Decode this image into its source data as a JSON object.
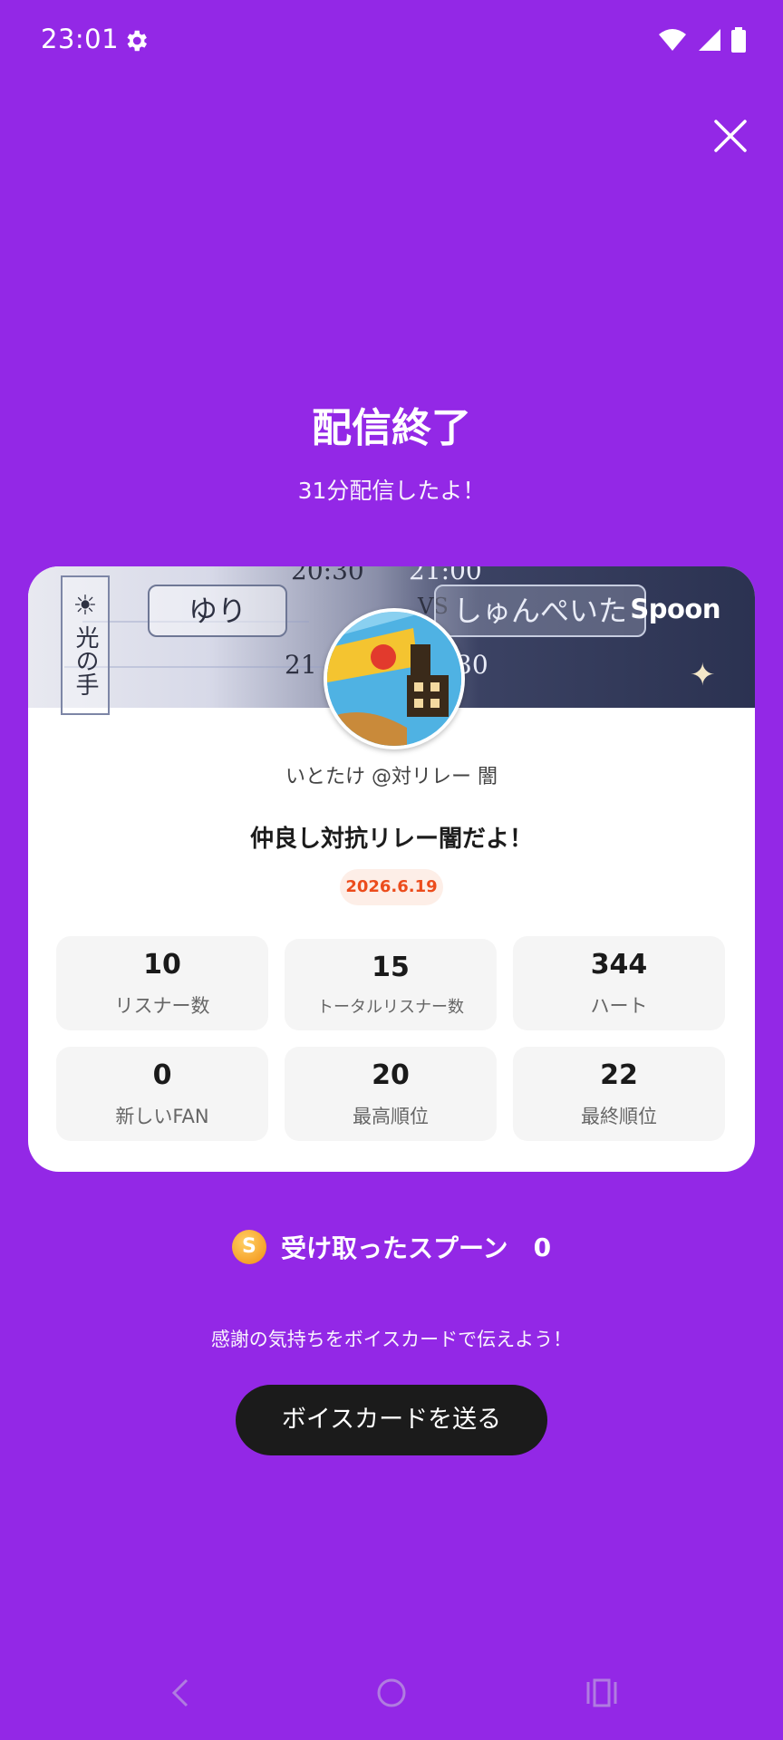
{
  "status_bar": {
    "time": "23:01"
  },
  "header": {
    "title": "配信終了",
    "subtitle": "31分配信したよ！"
  },
  "card": {
    "banner": {
      "texts": [
        "ゆり",
        "VS",
        "しゅんぺいた",
        "20:30",
        "21:00",
        "21",
        "30",
        "光の手"
      ],
      "logo": "Spoon"
    },
    "username": "いとたけ @対リレー 闇",
    "show_title": "仲良し対抗リレー闇だよ！",
    "date": "2026.6.19",
    "stats": [
      {
        "value": "10",
        "label": "リスナー数"
      },
      {
        "value": "15",
        "label": "トータルリスナー数"
      },
      {
        "value": "344",
        "label": "ハート"
      },
      {
        "value": "0",
        "label": "新しいFAN"
      },
      {
        "value": "20",
        "label": "最高順位"
      },
      {
        "value": "22",
        "label": "最終順位"
      }
    ]
  },
  "spoons": {
    "coin_letter": "S",
    "label": "受け取ったスプーン",
    "count": "0"
  },
  "thanks_message": "感謝の気持ちをボイスカードで伝えよう！",
  "voice_card_button": "ボイスカードを送る",
  "colors": {
    "background": "#9328E6",
    "date_badge_text": "#EC4C1C",
    "button": "#1B1B1B"
  }
}
